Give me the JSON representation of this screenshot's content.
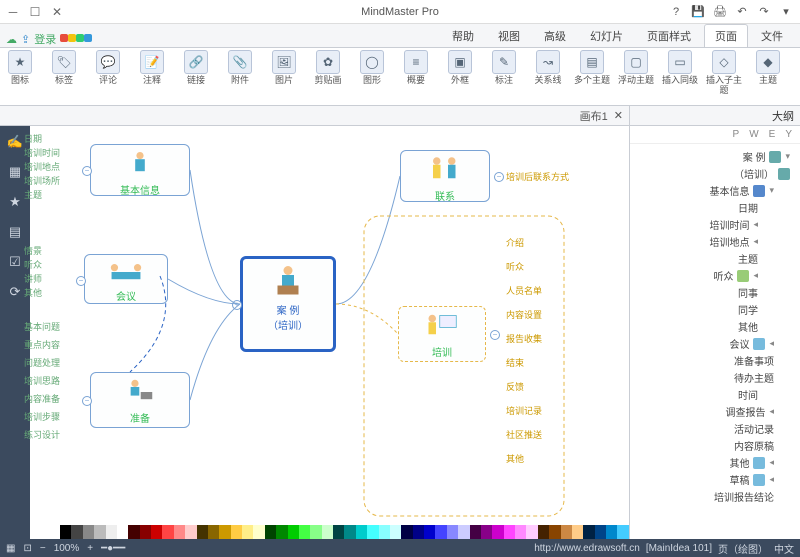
{
  "app_title": "MindMaster Pro",
  "login_label": "登录",
  "tabs": [
    "文件",
    "页面",
    "页面样式",
    "幻灯片",
    "高级",
    "视图",
    "帮助"
  ],
  "active_tab": 1,
  "ribbon": [
    {
      "label": "主题",
      "icon": "◆"
    },
    {
      "label": "插入子主题",
      "icon": "◇"
    },
    {
      "label": "插入同级",
      "icon": "▭"
    },
    {
      "label": "浮动主题",
      "icon": "▢"
    },
    {
      "label": "多个主题",
      "icon": "▤"
    },
    {
      "label": "关系线",
      "icon": "↝"
    },
    {
      "label": "标注",
      "icon": "✎"
    },
    {
      "label": "外框",
      "icon": "▣"
    },
    {
      "label": "概要",
      "icon": "≡"
    },
    {
      "label": "图形",
      "icon": "◯"
    },
    {
      "label": "剪贴画",
      "icon": "✿"
    },
    {
      "label": "图片",
      "icon": "🖼"
    },
    {
      "label": "附件",
      "icon": "📎"
    },
    {
      "label": "链接",
      "icon": "🔗"
    },
    {
      "label": "注释",
      "icon": "📝"
    },
    {
      "label": "评论",
      "icon": "💬"
    },
    {
      "label": "标签",
      "icon": "🏷"
    },
    {
      "label": "图标",
      "icon": "★"
    }
  ],
  "small_tools": [
    "✂",
    "⎘",
    "📋",
    "↶",
    "↷"
  ],
  "canvas_tab": "画布1",
  "outline_title": "大纲",
  "outline_tabs": [
    "P",
    "W",
    "E",
    "Y"
  ],
  "outline": [
    {
      "d": 1,
      "t": "案 例",
      "ico": "#6aa",
      "chev": "▾"
    },
    {
      "d": 1,
      "t": "（培训）",
      "ico": "#6aa"
    },
    {
      "d": 2,
      "t": "基本信息",
      "ico": "#58c",
      "chev": "▾"
    },
    {
      "d": 3,
      "t": "日期"
    },
    {
      "d": 3,
      "t": "培训时间",
      "chev": "◂"
    },
    {
      "d": 3,
      "t": "培训地点",
      "chev": "◂"
    },
    {
      "d": 3,
      "t": "主题"
    },
    {
      "d": 3,
      "t": "听众",
      "ico": "#9c7",
      "chev": "◂"
    },
    {
      "d": 3,
      "t": "同事"
    },
    {
      "d": 3,
      "t": "同学"
    },
    {
      "d": 3,
      "t": "其他"
    },
    {
      "d": 2,
      "t": "会议",
      "ico": "#7bd",
      "chev": "◂"
    },
    {
      "d": 2,
      "t": "准备事项"
    },
    {
      "d": 2,
      "t": "待办主题"
    },
    {
      "d": 3,
      "t": "时间"
    },
    {
      "d": 2,
      "t": "调查报告",
      "chev": "◂"
    },
    {
      "d": 2,
      "t": "活动记录"
    },
    {
      "d": 2,
      "t": "内容原稿"
    },
    {
      "d": 2,
      "t": "其他",
      "ico": "#7bd",
      "chev": "◂"
    },
    {
      "d": 2,
      "t": "草稿",
      "ico": "#7bd",
      "chev": "◂"
    },
    {
      "d": 2,
      "t": "培训报告结论"
    }
  ],
  "nodes": {
    "center": "案 例\n（培训）",
    "n1": "基本信息",
    "n2": "会议",
    "n3": "准备",
    "r1": "联系",
    "r2": "培训"
  },
  "twigs_left": [
    "日期",
    "培训时间",
    "培训地点",
    "培训场所",
    "主题",
    "情景",
    "听众",
    "讲师",
    "其他",
    "基本问题",
    "重点内容",
    "问题处理",
    "培训思路",
    "内容准备",
    "培训步骤",
    "练习设计"
  ],
  "twigs_right": [
    "培训后联系方式",
    "介绍",
    "听众",
    "人员名单",
    "内容设置",
    "报告收集",
    "结束",
    "反馈",
    "培训记录",
    "社区推送",
    "其他"
  ],
  "color_swatches": [
    "#000",
    "#444",
    "#888",
    "#bbb",
    "#eee",
    "#fff",
    "#400",
    "#800",
    "#c00",
    "#f44",
    "#f88",
    "#fcc",
    "#430",
    "#860",
    "#c90",
    "#fc4",
    "#fe8",
    "#ffc",
    "#040",
    "#080",
    "#0c0",
    "#4f4",
    "#8f8",
    "#cfc",
    "#044",
    "#088",
    "#0cc",
    "#4ff",
    "#8ff",
    "#cff",
    "#004",
    "#008",
    "#00c",
    "#44f",
    "#88f",
    "#ccf",
    "#404",
    "#808",
    "#c0c",
    "#f4f",
    "#f8f",
    "#fcf",
    "#420",
    "#840",
    "#c84",
    "#fc8",
    "#024",
    "#048",
    "#08c",
    "#4cf"
  ],
  "status": {
    "zoom": "100%",
    "url": "http://www.edrawsoft.cn",
    "doc": "[MainIdea 101]",
    "page": "页（绘图）",
    "lang": "中文"
  }
}
